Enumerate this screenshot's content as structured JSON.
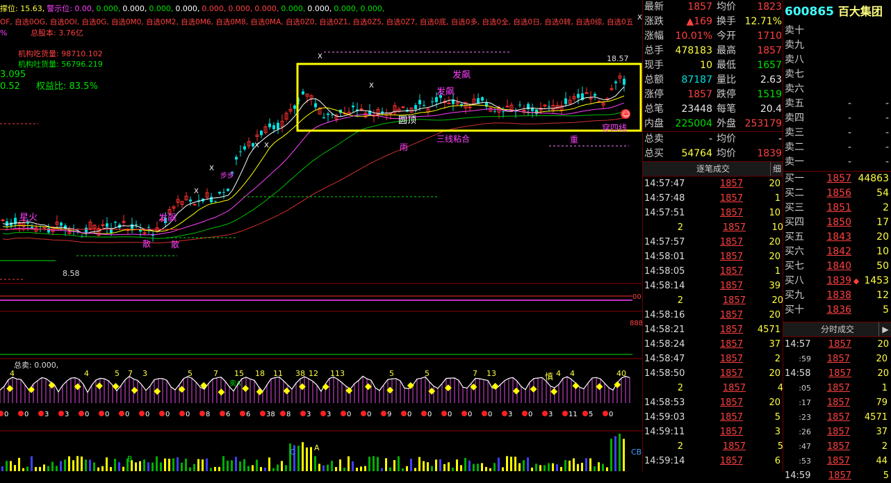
{
  "indicator_top": {
    "line1": [
      "撑位: 15.63,",
      "警示位: 0.00,",
      "0.000,",
      "0.000,",
      "0.000,",
      "0.000,",
      "0.000,",
      "0.000,",
      "0.000,",
      "0.000,",
      "0.000,",
      "0.000,",
      "0.000,"
    ],
    "line2": "OF, 自选0OG, 自选0OI, 自选0G, 自选0M0, 自选0M2, 自选0M6, 自选0M8, 自选0MA, 自选0Z0, 自选0Z1, 自选0Z5, 自选0Z7, 自选0底, 自选0多, 自选0全, 自选0日, 自选0转, 自选0综, 自选0五",
    "line3_pct": "%",
    "total_shares": "总股本: 3.76亿",
    "inst_buy": "机构吃货量: 98710.102",
    "inst_sell": "机构吐货量: 56796.219",
    "price_left": "3.095",
    "ratio_left": "0.52",
    "equity_ratio": "权益比: 83.5%"
  },
  "chart_labels": {
    "high_price": "18.57",
    "low_price": "8.58",
    "fa_piao_1": "发飙",
    "fa_piao_2": "发飙",
    "fa_piao_3": "发飙",
    "yuan_ding": "圆顶",
    "san_xian": "三线粘合",
    "chuan_si_xian": "穿四线",
    "yu": "雨",
    "xing_huo": "星火",
    "san_1": "散",
    "san_2": "散",
    "bu_bu": "步步",
    "zhong": "重",
    "shen": "慎",
    "x_marks": [
      "X",
      "X",
      "X",
      "X",
      "X",
      "X",
      "X"
    ],
    "smiley": "☺",
    "lower_label": "总卖: 0.000,",
    "sell_a": "卖A"
  },
  "sub_panel_numbers": [
    "4",
    "4",
    "5",
    "7",
    "3",
    "5",
    "7",
    "15",
    "18",
    "11",
    "38",
    "12",
    "113",
    "5",
    "5",
    "7",
    "13",
    "4",
    "4",
    "40"
  ],
  "bottom_numbers": [
    "0",
    "0",
    "3",
    "3",
    "0",
    "0",
    "0",
    "0",
    "0",
    "0",
    "8",
    "6",
    "6",
    "38",
    "8",
    "3",
    "3",
    "0",
    "0",
    "9",
    "0",
    "0",
    "0",
    "0",
    "0",
    "3",
    "0",
    "3",
    "11",
    "5",
    "0"
  ],
  "quote": {
    "rows": [
      {
        "l1": "最新",
        "v1": "1857",
        "c1": "red",
        "l2": "均价",
        "v2": "1823",
        "c2": "red"
      },
      {
        "l1": "涨跌",
        "v1": "▲169",
        "c1": "red",
        "l2": "换手",
        "v2": "12.71%",
        "c2": "yellow"
      },
      {
        "l1": "涨幅",
        "v1": "10.01%",
        "c1": "red",
        "l2": "今开",
        "v2": "1710",
        "c2": "red"
      },
      {
        "l1": "总手",
        "v1": "478183",
        "c1": "yellow",
        "l2": "最高",
        "v2": "1857",
        "c2": "red"
      },
      {
        "l1": "现手",
        "v1": "10",
        "c1": "yellow",
        "l2": "最低",
        "v2": "1657",
        "c2": "green"
      },
      {
        "l1": "总额",
        "v1": "87187",
        "c1": "cyan",
        "l2": "量比",
        "v2": "2.63",
        "c2": "white"
      },
      {
        "l1": "涨停",
        "v1": "1857",
        "c1": "red",
        "l2": "跌停",
        "v2": "1519",
        "c2": "green"
      },
      {
        "l1": "总笔",
        "v1": "23448",
        "c1": "white",
        "l2": "每笔",
        "v2": "20.4",
        "c2": "white"
      },
      {
        "l1": "内盘",
        "v1": "225004",
        "c1": "green",
        "l2": "外盘",
        "v2": "253179",
        "c2": "red"
      },
      {
        "l1": "总卖",
        "v1": "-",
        "c1": "white",
        "l2": "均价",
        "v2": "-",
        "c2": "white"
      },
      {
        "l1": "总买",
        "v1": "54764",
        "c1": "yellow",
        "l2": "均价",
        "v2": "1839",
        "c2": "red"
      }
    ]
  },
  "tick_header": {
    "title": "逐笔成交",
    "tag": "细"
  },
  "ticks": [
    {
      "t": "14:57:47",
      "p": "1857",
      "v": "20",
      "vc": "yellow"
    },
    {
      "t": "14:57:48",
      "p": "1857",
      "v": "1",
      "vc": "yellow"
    },
    {
      "t": "14:57:51",
      "p": "1857",
      "v": "10",
      "vc": "yellow"
    },
    {
      "t": "2",
      "p": "1857",
      "v": "10",
      "vc": "yellow",
      "tc": "yellow",
      "indent": true
    },
    {
      "t": "14:57:57",
      "p": "1857",
      "v": "20",
      "vc": "yellow"
    },
    {
      "t": "14:58:01",
      "p": "1857",
      "v": "20",
      "vc": "yellow"
    },
    {
      "t": "14:58:05",
      "p": "1857",
      "v": "1",
      "vc": "yellow"
    },
    {
      "t": "14:58:14",
      "p": "1857",
      "v": "39",
      "vc": "yellow"
    },
    {
      "t": "2",
      "p": "1857",
      "v": "20",
      "vc": "yellow",
      "tc": "yellow",
      "indent": true
    },
    {
      "t": "14:58:16",
      "p": "1857",
      "v": "20",
      "vc": "yellow"
    },
    {
      "t": "14:58:21",
      "p": "1857",
      "v": "4571",
      "vc": "yellow"
    },
    {
      "t": "14:58:24",
      "p": "1857",
      "v": "37",
      "vc": "yellow"
    },
    {
      "t": "14:58:47",
      "p": "1857",
      "v": "2",
      "vc": "yellow"
    },
    {
      "t": "14:58:50",
      "p": "1857",
      "v": "20",
      "vc": "yellow"
    },
    {
      "t": "2",
      "p": "1857",
      "v": "4",
      "vc": "yellow",
      "tc": "yellow",
      "indent": true
    },
    {
      "t": "14:58:53",
      "p": "1857",
      "v": "20",
      "vc": "yellow"
    },
    {
      "t": "14:59:03",
      "p": "1857",
      "v": "5",
      "vc": "yellow"
    },
    {
      "t": "14:59:11",
      "p": "1857",
      "v": "3",
      "vc": "yellow"
    },
    {
      "t": "2",
      "p": "1857",
      "v": "5",
      "vc": "yellow",
      "tc": "yellow",
      "indent": true
    },
    {
      "t": "14:59:14",
      "p": "1857",
      "v": "6",
      "vc": "yellow"
    }
  ],
  "stock": {
    "code": "600865",
    "name": "百大集团"
  },
  "sell_orders": [
    {
      "l": "卖十",
      "p": "",
      "v": ""
    },
    {
      "l": "卖九",
      "p": "",
      "v": ""
    },
    {
      "l": "卖八",
      "p": "",
      "v": ""
    },
    {
      "l": "卖七",
      "p": "",
      "v": ""
    },
    {
      "l": "卖六",
      "p": "",
      "v": ""
    },
    {
      "l": "卖五",
      "p": "-",
      "v": "-"
    },
    {
      "l": "卖四",
      "p": "-",
      "v": "-"
    },
    {
      "l": "卖三",
      "p": "-",
      "v": "-"
    },
    {
      "l": "卖二",
      "p": "-",
      "v": "-"
    },
    {
      "l": "卖一",
      "p": "-",
      "v": "-"
    }
  ],
  "buy_orders": [
    {
      "l": "买一",
      "p": "1857",
      "v": "44863"
    },
    {
      "l": "买二",
      "p": "1856",
      "v": "54"
    },
    {
      "l": "买三",
      "p": "1851",
      "v": "2"
    },
    {
      "l": "买四",
      "p": "1850",
      "v": "17"
    },
    {
      "l": "买五",
      "p": "1843",
      "v": "20"
    },
    {
      "l": "买六",
      "p": "1842",
      "v": "10"
    },
    {
      "l": "买七",
      "p": "1840",
      "v": "50"
    },
    {
      "l": "买八",
      "p": "1839",
      "v": "1453",
      "mark": "◆"
    },
    {
      "l": "买九",
      "p": "1838",
      "v": "12"
    },
    {
      "l": "买十",
      "p": "1836",
      "v": "5"
    }
  ],
  "minute_header": {
    "title": "分时成交",
    "arrow": "▶"
  },
  "minute_trades": [
    {
      "t": "14:57",
      "p": "1857",
      "v": "20"
    },
    {
      "t": ":59",
      "p": "1857",
      "v": "20"
    },
    {
      "t": "14:58",
      "p": "1857",
      "v": "20"
    },
    {
      "t": ":05",
      "p": "1857",
      "v": "1"
    },
    {
      "t": ":17",
      "p": "1857",
      "v": "79"
    },
    {
      "t": ":23",
      "p": "1857",
      "v": "4571"
    },
    {
      "t": ":26",
      "p": "1857",
      "v": "37"
    },
    {
      "t": ":47",
      "p": "1857",
      "v": "2"
    },
    {
      "t": ":53",
      "p": "1857",
      "v": "44"
    },
    {
      "t": "14:59",
      "p": "1857",
      "v": "5"
    }
  ]
}
